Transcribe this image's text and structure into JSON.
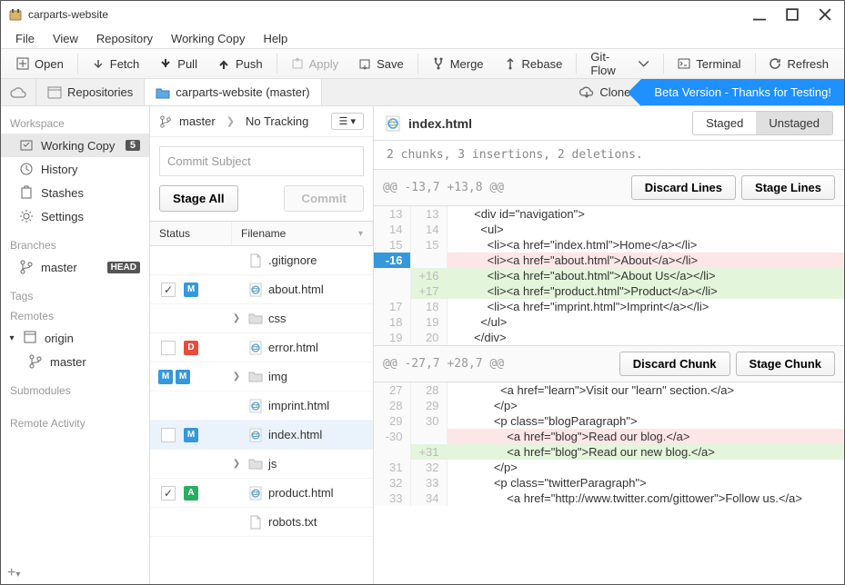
{
  "window": {
    "title": "carparts-website"
  },
  "menu": [
    "File",
    "View",
    "Repository",
    "Working Copy",
    "Help"
  ],
  "toolbar": {
    "open": "Open",
    "fetch": "Fetch",
    "pull": "Pull",
    "push": "Push",
    "apply": "Apply",
    "save": "Save",
    "merge": "Merge",
    "rebase": "Rebase",
    "gitflow": "Git-Flow",
    "terminal": "Terminal",
    "refresh": "Refresh"
  },
  "breadcrumb": {
    "repositories": "Repositories",
    "repo": "carparts-website (master)",
    "clone": "Clone",
    "beta": "Beta Version - Thanks for Testing!"
  },
  "sidebar": {
    "workspace": "Workspace",
    "working_copy": "Working Copy",
    "working_copy_count": "5",
    "history": "History",
    "stashes": "Stashes",
    "settings": "Settings",
    "branches": "Branches",
    "master": "master",
    "head": "HEAD",
    "tags": "Tags",
    "remotes": "Remotes",
    "origin": "origin",
    "origin_master": "master",
    "submodules": "Submodules",
    "remote_activity": "Remote Activity"
  },
  "commit": {
    "branch": "master",
    "tracking": "No Tracking",
    "placeholder": "Commit Subject",
    "stage_all": "Stage All",
    "commit": "Commit",
    "col_status": "Status",
    "col_filename": "Filename"
  },
  "files": [
    {
      "name": ".gitignore",
      "type": "file"
    },
    {
      "name": "about.html",
      "type": "html",
      "checked": true,
      "badges": [
        "M"
      ]
    },
    {
      "name": "css",
      "type": "folder",
      "caret": true
    },
    {
      "name": "error.html",
      "type": "html",
      "badges": [
        "D"
      ]
    },
    {
      "name": "img",
      "type": "folder",
      "caret": true,
      "badges": [
        "M",
        "M"
      ]
    },
    {
      "name": "imprint.html",
      "type": "html"
    },
    {
      "name": "index.html",
      "type": "html",
      "badges": [
        "M"
      ],
      "selected": true
    },
    {
      "name": "js",
      "type": "folder",
      "caret": true
    },
    {
      "name": "product.html",
      "type": "html",
      "checked": true,
      "badges": [
        "A"
      ]
    },
    {
      "name": "robots.txt",
      "type": "file"
    }
  ],
  "diff": {
    "filename": "index.html",
    "staged": "Staged",
    "unstaged": "Unstaged",
    "summary": "2 chunks, 3 insertions, 2 deletions.",
    "discard_lines": "Discard Lines",
    "stage_lines": "Stage Lines",
    "discard_chunk": "Discard Chunk",
    "stage_chunk": "Stage Chunk",
    "chunk1_range": "@@ -13,7 +13,8 @@",
    "chunk2_range": "@@ -27,7 +28,7 @@",
    "c1": {
      "l1": "      <div id=\"navigation\">",
      "l2": "        <ul>",
      "l3": "          <li><a href=\"index.html\">Home</a></li>",
      "l4": "          <li><a href=\"about.html\">About</a></li>",
      "l5": "          <li><a href=\"about.html\">About Us</a></li>",
      "l6": "          <li><a href=\"product.html\">Product</a></li>",
      "l7": "          <li><a href=\"imprint.html\">Imprint</a></li>",
      "l8": "        </ul>",
      "l9": "      </div>"
    },
    "c2": {
      "l1": "              <a href=\"learn\">Visit our \"learn\" section.</a>",
      "l2": "            </p>",
      "l3": "            <p class=\"blogParagraph\">",
      "l4": "                <a href=\"blog\">Read our blog.</a>",
      "l5": "                <a href=\"blog\">Read our new blog.</a>",
      "l6": "            </p>",
      "l7": "            <p class=\"twitterParagraph\">",
      "l8": "                <a href=\"http://www.twitter.com/gittower\">Follow us.</a>"
    }
  }
}
